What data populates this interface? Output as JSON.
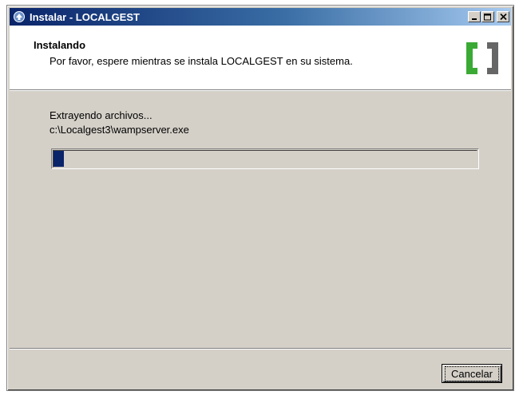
{
  "window": {
    "title": "Instalar - LOCALGEST",
    "minimize_label": "_",
    "maximize_label": "□",
    "close_label": "✕"
  },
  "header": {
    "title": "Instalando",
    "subtitle": "Por favor, espere mientras se instala LOCALGEST en su sistema."
  },
  "content": {
    "status_text": "Extrayendo archivos...",
    "current_file": "c:\\Localgest3\\wampserver.exe",
    "progress_fraction": 0.025
  },
  "footer": {
    "cancel_label": "Cancelar"
  },
  "colors": {
    "titlebar_start": "#0a246a",
    "titlebar_end": "#a6caf0",
    "progress_fill": "#0a246a",
    "logo_green": "#3aaa35",
    "logo_gray": "#666666",
    "dialog_bg": "#d4d0c8"
  },
  "icons": {
    "app_icon": "installer-icon",
    "logo": "localgest-logo"
  }
}
